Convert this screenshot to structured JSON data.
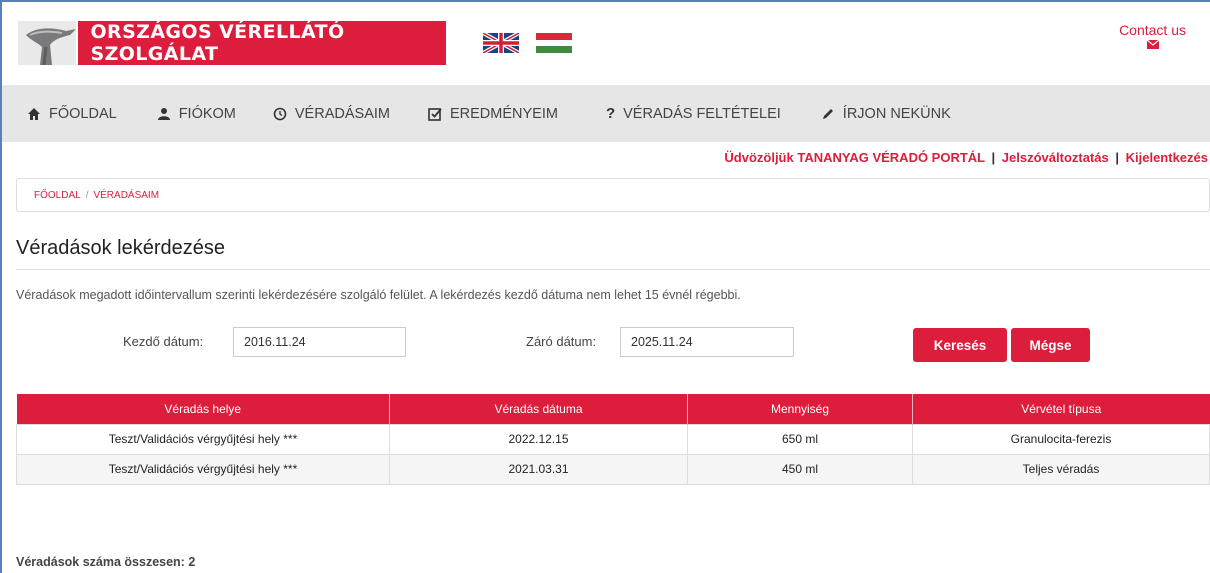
{
  "header": {
    "logo_text": "ORSZÁGOS VÉRELLÁTÓ SZOLGÁLAT",
    "contact_label": "Contact us",
    "brand_color": "#dc1d3c"
  },
  "nav": {
    "items": [
      {
        "label": "FŐOLDAL",
        "icon": "home-icon"
      },
      {
        "label": "FIÓKOM",
        "icon": "user-icon"
      },
      {
        "label": "VÉRADÁSAIM",
        "icon": "clock-icon"
      },
      {
        "label": "EREDMÉNYEIM",
        "icon": "checkbox-icon"
      },
      {
        "label": "VÉRADÁS FELTÉTELEI",
        "icon": "question-icon"
      },
      {
        "label": "ÍRJON NEKÜNK",
        "icon": "pencil-icon"
      }
    ]
  },
  "welcome": {
    "greeting": "Üdvözöljük TANANYAG VÉRADÓ PORTÁL",
    "separator": "|",
    "change_password": "Jelszóváltoztatás",
    "logout": "Kijelentkezés"
  },
  "breadcrumb": {
    "home": "FŐOLDAL",
    "separator": "/",
    "current": "VÉRADÁSAIM"
  },
  "page": {
    "title": "Véradások lekérdezése",
    "description": "Véradások megadott időintervallum szerinti lekérdezésére szolgáló felület. A lekérdezés kezdő dátuma nem lehet 15 évnél régebbi."
  },
  "form": {
    "start_label": "Kezdő dátum:",
    "start_value": "2016.11.24",
    "end_label": "Záró dátum:",
    "end_value": "2025.11.24",
    "search_button": "Keresés",
    "cancel_button": "Mégse"
  },
  "table": {
    "headers": [
      "Véradás helye",
      "Véradás dátuma",
      "Mennyiség",
      "Vérvétel típusa"
    ],
    "rows": [
      [
        "Teszt/Validációs vérgyűjtési hely ***",
        "2022.12.15",
        "650 ml",
        "Granulocita-ferezis"
      ],
      [
        "Teszt/Validációs vérgyűjtési hely ***",
        "2021.03.31",
        "450 ml",
        "Teljes véradás"
      ]
    ]
  },
  "summary": {
    "total_label": "Véradások száma összesen: 2"
  }
}
